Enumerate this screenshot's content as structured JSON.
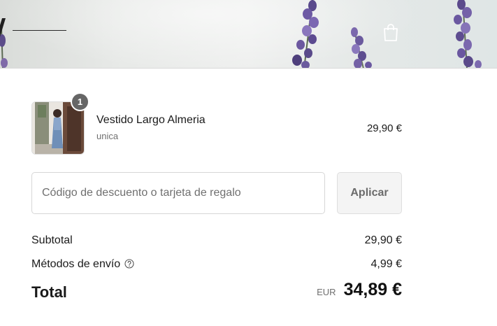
{
  "header": {
    "logo": "logo-mark",
    "cart_icon": "shopping-bag-icon",
    "hero_image": "lavender-field-photo"
  },
  "line_item": {
    "quantity": "1",
    "name": "Vestido Largo Almeria",
    "variant": "unica",
    "price": "29,90 €",
    "image": "dress-product-photo"
  },
  "discount": {
    "placeholder": "Código de descuento o tarjeta de regalo",
    "value": "",
    "apply_label": "Aplicar"
  },
  "summary": {
    "subtotal_label": "Subtotal",
    "subtotal_value": "29,90 €",
    "shipping_label": "Métodos de envío",
    "shipping_value": "4,99 €",
    "shipping_help_icon": "question-circle-icon",
    "total_label": "Total",
    "total_currency": "EUR",
    "total_value": "34,89 €"
  },
  "colors": {
    "text": "#1a1a1a",
    "muted": "#707070",
    "badge": "#666666",
    "button_bg": "#f4f4f4",
    "border": "#d6d6d6",
    "lavender": "#6b5a9e"
  }
}
